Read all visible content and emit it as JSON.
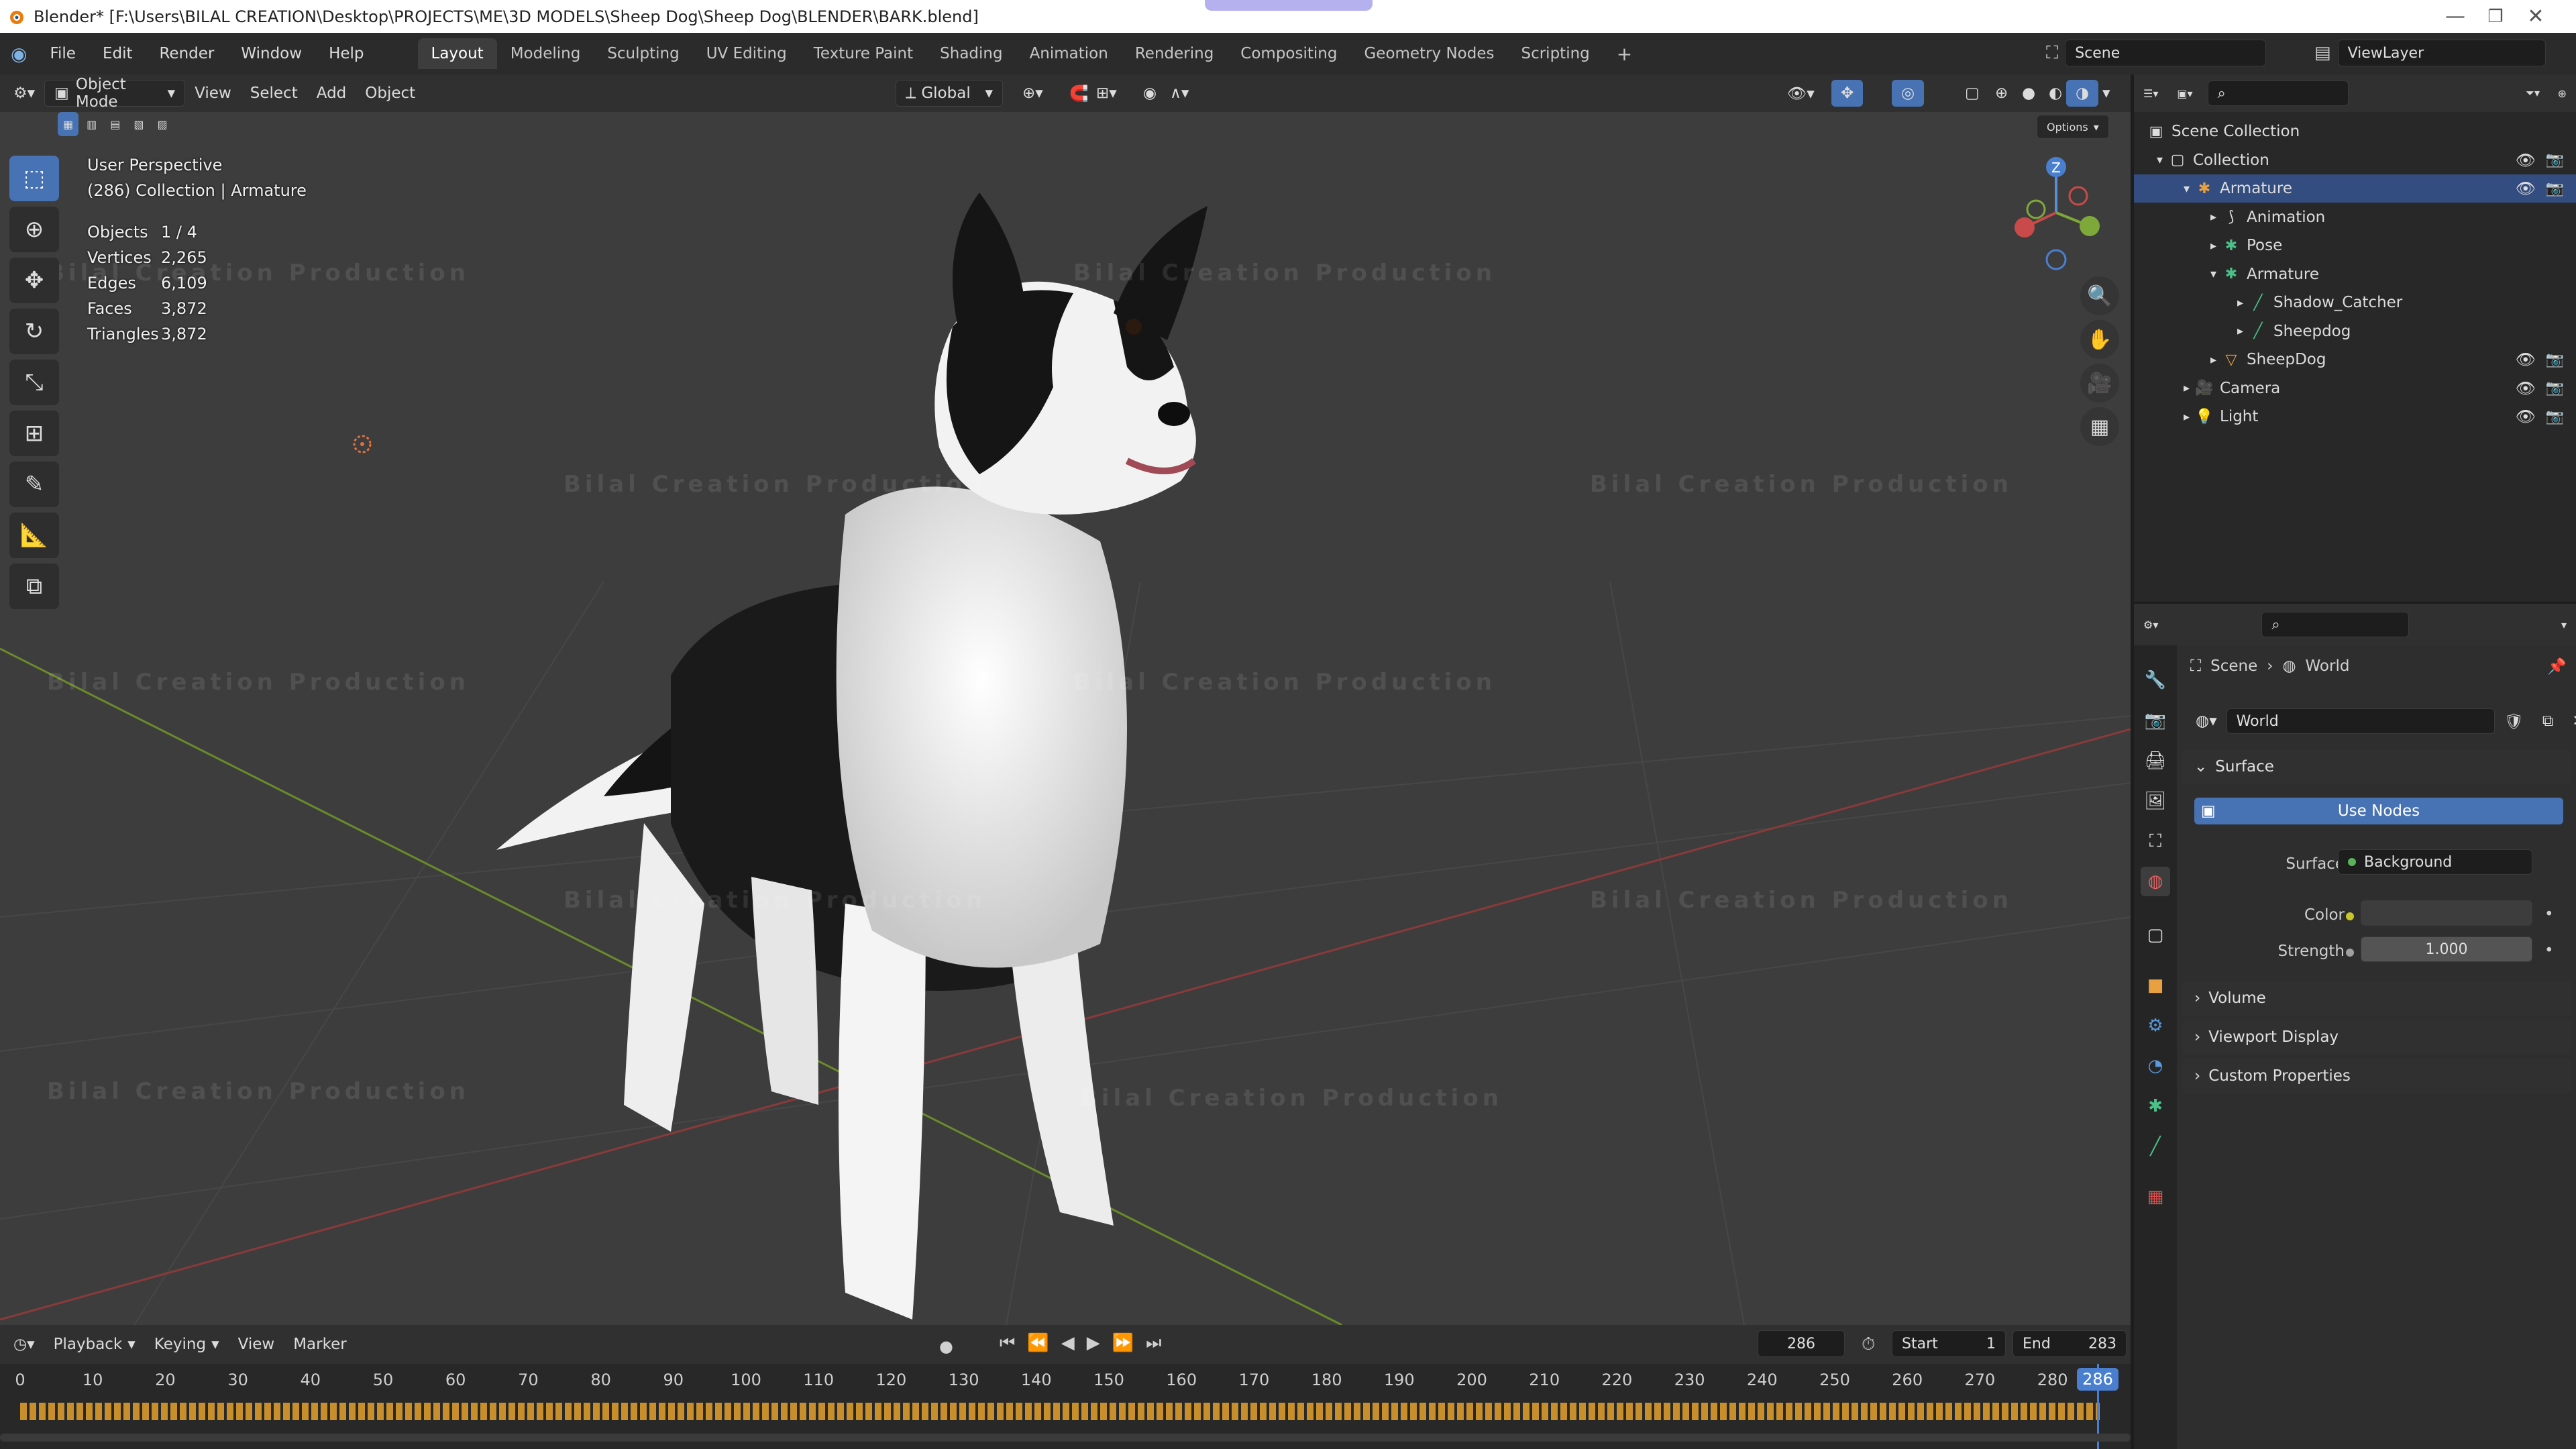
{
  "window": {
    "title": "Blender* [F:\\Users\\BILAL CREATION\\Desktop\\PROJECTS\\ME\\3D MODELS\\Sheep Dog\\Sheep Dog\\BLENDER\\BARK.blend]",
    "minimize": "—",
    "maximize": "❐",
    "close": "✕"
  },
  "menu": {
    "items": [
      "File",
      "Edit",
      "Render",
      "Window",
      "Help"
    ],
    "workspaces": [
      "Layout",
      "Modeling",
      "Sculpting",
      "UV Editing",
      "Texture Paint",
      "Shading",
      "Animation",
      "Rendering",
      "Compositing",
      "Geometry Nodes",
      "Scripting"
    ],
    "active_workspace": "Layout",
    "add_tab": "+",
    "scene": "Scene",
    "view_layer": "ViewLayer"
  },
  "viewport_header": {
    "mode": "Object Mode",
    "menus": [
      "View",
      "Select",
      "Add",
      "Object"
    ],
    "orientation": "Global",
    "options": "Options"
  },
  "viewport": {
    "view_name": "User Perspective",
    "context": "(286) Collection | Armature",
    "stats": [
      {
        "label": "Objects",
        "value": "1 / 4"
      },
      {
        "label": "Vertices",
        "value": "2,265"
      },
      {
        "label": "Edges",
        "value": "6,109"
      },
      {
        "label": "Faces",
        "value": "3,872"
      },
      {
        "label": "Triangles",
        "value": "3,872"
      }
    ],
    "watermark": "Bilal Creation Production",
    "gizmo_axis": "Z"
  },
  "timeline": {
    "menus": [
      "Playback",
      "Keying",
      "View",
      "Marker"
    ],
    "current_frame": "286",
    "start_label": "Start",
    "start": "1",
    "end_label": "End",
    "end": "283",
    "ticks": [
      "0",
      "10",
      "20",
      "30",
      "40",
      "50",
      "60",
      "70",
      "80",
      "90",
      "100",
      "110",
      "120",
      "130",
      "140",
      "150",
      "160",
      "170",
      "180",
      "190",
      "200",
      "210",
      "220",
      "230",
      "240",
      "250",
      "260",
      "270",
      "280"
    ],
    "playhead_label": "286"
  },
  "outliner": {
    "rows": [
      {
        "name": "Scene Collection",
        "depth": 0,
        "icon": "scene-collection-icon",
        "selected": false,
        "vis": false
      },
      {
        "name": "Collection",
        "depth": 1,
        "icon": "collection-icon",
        "selected": false,
        "vis": true
      },
      {
        "name": "Armature",
        "depth": 2,
        "icon": "armature-icon",
        "selected": true,
        "vis": true
      },
      {
        "name": "Animation",
        "depth": 3,
        "icon": "animation-icon",
        "selected": false,
        "vis": false
      },
      {
        "name": "Pose",
        "depth": 3,
        "icon": "pose-icon",
        "selected": false,
        "vis": false
      },
      {
        "name": "Armature",
        "depth": 3,
        "icon": "armature-data-icon",
        "selected": false,
        "vis": false
      },
      {
        "name": "Shadow_Catcher",
        "depth": 4,
        "icon": "bone-icon",
        "selected": false,
        "vis": false
      },
      {
        "name": "Sheepdog",
        "depth": 4,
        "icon": "bone-icon",
        "selected": false,
        "vis": false
      },
      {
        "name": "SheepDog",
        "depth": 3,
        "icon": "mesh-icon",
        "selected": false,
        "vis": true
      },
      {
        "name": "Camera",
        "depth": 2,
        "icon": "camera-icon",
        "selected": false,
        "vis": true
      },
      {
        "name": "Light",
        "depth": 2,
        "icon": "light-icon",
        "selected": false,
        "vis": true
      }
    ]
  },
  "properties": {
    "breadcrumb_scene": "Scene",
    "breadcrumb_world": "World",
    "world_name": "World",
    "surface_panel": "Surface",
    "use_nodes": "Use Nodes",
    "surface_label": "Surface",
    "surface_value": "Background",
    "color_label": "Color",
    "strength_label": "Strength",
    "strength_value": "1.000",
    "panels": [
      "Volume",
      "Viewport Display",
      "Custom Properties"
    ],
    "colors": {
      "accent": "#4772b3",
      "selected_row": "#334d80",
      "shader_dot": "#59b359",
      "color_dot": "#c7c729"
    }
  }
}
